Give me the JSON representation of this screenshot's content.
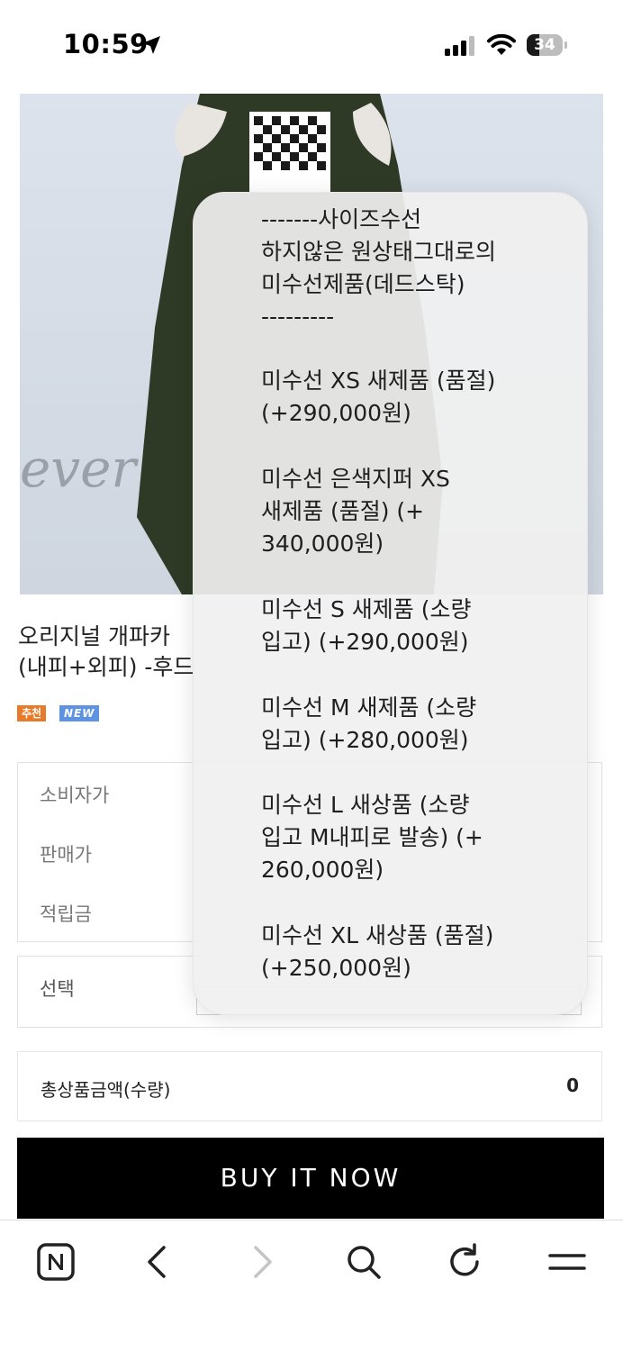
{
  "status_bar": {
    "time": "10:59",
    "battery": "34",
    "icons": [
      "location-arrow-icon",
      "signal-icon",
      "wifi-icon",
      "battery-icon"
    ]
  },
  "product": {
    "image_text": "ever",
    "title_lines": [
      "오리지널 개파카",
      "(내피+외피) -후드"
    ],
    "badges": {
      "recommended": "추천",
      "new": "NEW"
    },
    "badge_colors": {
      "recommended": "#e87b2a",
      "new": "#5d93e0"
    }
  },
  "price_info": {
    "consumer_price_label": "소비자가",
    "sale_price_label": "판매가",
    "points_label": "적립금"
  },
  "option": {
    "label": "선택"
  },
  "total": {
    "label": "총상품금액(수량)",
    "value": "0"
  },
  "buy_button": {
    "label": "BUY IT NOW"
  },
  "dropdown": {
    "items": [
      {
        "lines": [
          "-------사이즈수선",
          "하지않은 원상태그대로의",
          "미수선제품(데드스탁)",
          "---------"
        ]
      },
      {
        "lines": [
          "미수선 XS 새제품 (품절)",
          "(+290,000원)"
        ]
      },
      {
        "lines": [
          "미수선 은색지퍼 XS",
          "새제품 (품절) (+",
          "340,000원)"
        ]
      },
      {
        "lines": [
          "미수선 S 새제품 (소량",
          "입고) (+290,000원)"
        ]
      },
      {
        "lines": [
          "미수선 M 새제품 (소량",
          "입고) (+280,000원)"
        ]
      },
      {
        "lines": [
          "미수선 L 새상품 (소량",
          "입고 M내피로 발송) (+",
          "260,000원)"
        ]
      },
      {
        "lines": [
          "미수선 XL 새상품 (품절)",
          "(+250,000원)"
        ]
      }
    ]
  },
  "toolbar": {
    "icons": [
      "naver-home-icon",
      "back-icon",
      "forward-icon",
      "search-icon",
      "reload-icon",
      "menu-icon"
    ]
  }
}
